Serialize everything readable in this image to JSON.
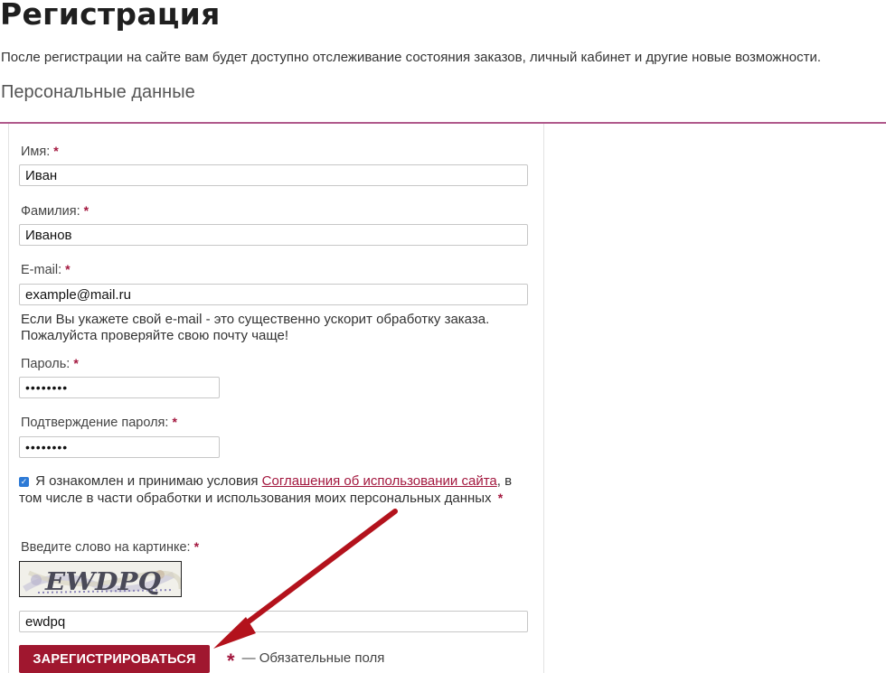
{
  "page": {
    "title": "Регистрация",
    "intro": "После регистрации на сайте вам будет доступно отслеживание состояния заказов, личный кабинет и другие новые возможности.",
    "section_title": "Персональные данные"
  },
  "required_mark": "*",
  "form": {
    "first_name": {
      "label": "Имя:",
      "value": "Иван"
    },
    "last_name": {
      "label": "Фамилия:",
      "value": "Иванов"
    },
    "email": {
      "label": "E-mail:",
      "value": "example@mail.ru",
      "hint_line1": "Если Вы укажете свой e-mail - это существенно ускорит обработку заказа.",
      "hint_line2": "Пожалуйста проверяйте свою почту чаще!"
    },
    "password": {
      "label": "Пароль:",
      "value": "••••••••"
    },
    "password_confirm": {
      "label": "Подтверждение пароля:",
      "value": "••••••••"
    },
    "agreement": {
      "checked": true,
      "text_before": "Я ознакомлен и принимаю условия",
      "link_text": "Соглашения об использовании сайта",
      "text_after": ", в том числе в части обработки и использования моих персональных данных"
    },
    "captcha": {
      "label": "Введите слово на картинке:",
      "image_text": "EWDPQ",
      "value": "ewdpq"
    },
    "submit_label": "ЗАРЕГИСТРИРОВАТЬСЯ",
    "required_legend": "— Обязательные поля"
  },
  "colors": {
    "accent": "#a0172f",
    "section_line": "#b05a8c",
    "link": "#a3173e",
    "checkbox": "#2d7ad6"
  },
  "icons": {
    "checkbox": "checkmark-icon",
    "annotation": "red-arrow-icon"
  }
}
